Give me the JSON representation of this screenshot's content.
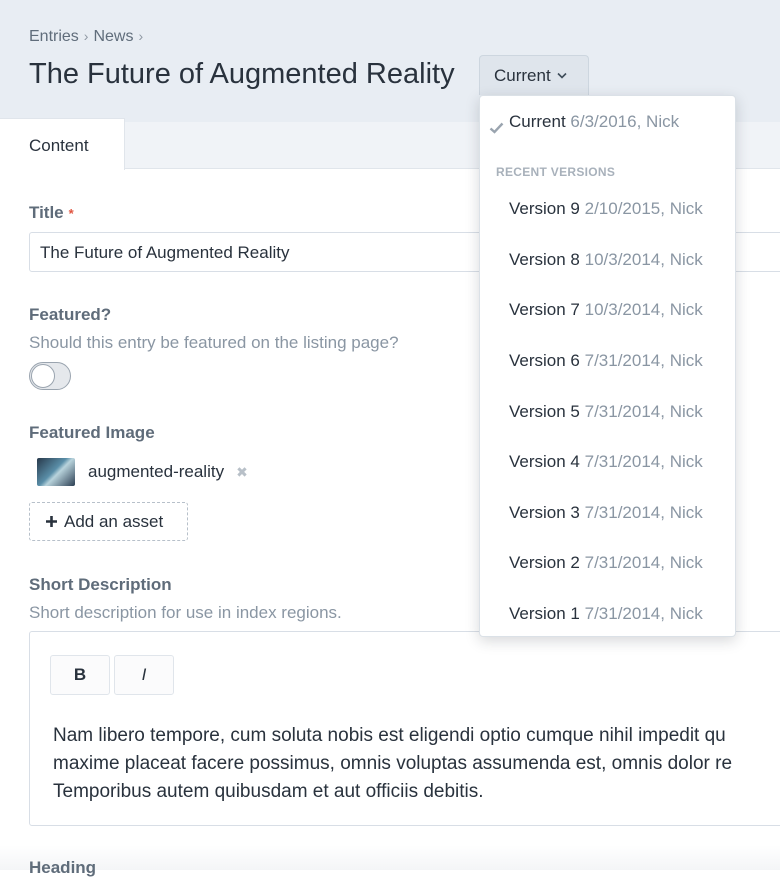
{
  "breadcrumb": [
    "Entries",
    "News"
  ],
  "breadcrumb_sep": "›",
  "page_title": "The Future of Augmented Reality",
  "version_button": {
    "label": "Current"
  },
  "tabs": [
    {
      "label": "Content"
    }
  ],
  "fields": {
    "title": {
      "label": "Title",
      "required_mark": "*",
      "value": "The Future of Augmented Reality"
    },
    "featured": {
      "label": "Featured?",
      "instructions": "Should this entry be featured on the listing page?",
      "on": false
    },
    "featured_image": {
      "label": "Featured Image",
      "asset_name": "augmented-reality",
      "remove_glyph": "✖",
      "add_label": "Add an asset"
    },
    "short_description": {
      "label": "Short Description",
      "instructions": "Short description for use in index regions.",
      "bold_label": "B",
      "italic_label": "I",
      "lines": [
        "Nam libero tempore, cum soluta nobis est eligendi optio cumque nihil impedit qu",
        "maxime placeat facere possimus, omnis voluptas assumenda est, omnis dolor re",
        "Temporibus autem quibusdam et aut officiis debitis."
      ]
    },
    "heading": {
      "label": "Heading"
    }
  },
  "versions_menu": {
    "current": {
      "label": "Current",
      "meta": "6/3/2016, Nick"
    },
    "recent_heading": "RECENT VERSIONS",
    "items": [
      {
        "label": "Version 9",
        "meta": "2/10/2015, Nick"
      },
      {
        "label": "Version 8",
        "meta": "10/3/2014, Nick"
      },
      {
        "label": "Version 7",
        "meta": "10/3/2014, Nick"
      },
      {
        "label": "Version 6",
        "meta": "7/31/2014, Nick"
      },
      {
        "label": "Version 5",
        "meta": "7/31/2014, Nick"
      },
      {
        "label": "Version 4",
        "meta": "7/31/2014, Nick"
      },
      {
        "label": "Version 3",
        "meta": "7/31/2014, Nick"
      },
      {
        "label": "Version 2",
        "meta": "7/31/2014, Nick"
      },
      {
        "label": "Version 1",
        "meta": "7/31/2014, Nick"
      }
    ]
  },
  "colors": {
    "header_bg": "#e8edf3",
    "required": "#e0533e",
    "muted_text": "#8a96a3",
    "label_text": "#5f6c7a"
  }
}
